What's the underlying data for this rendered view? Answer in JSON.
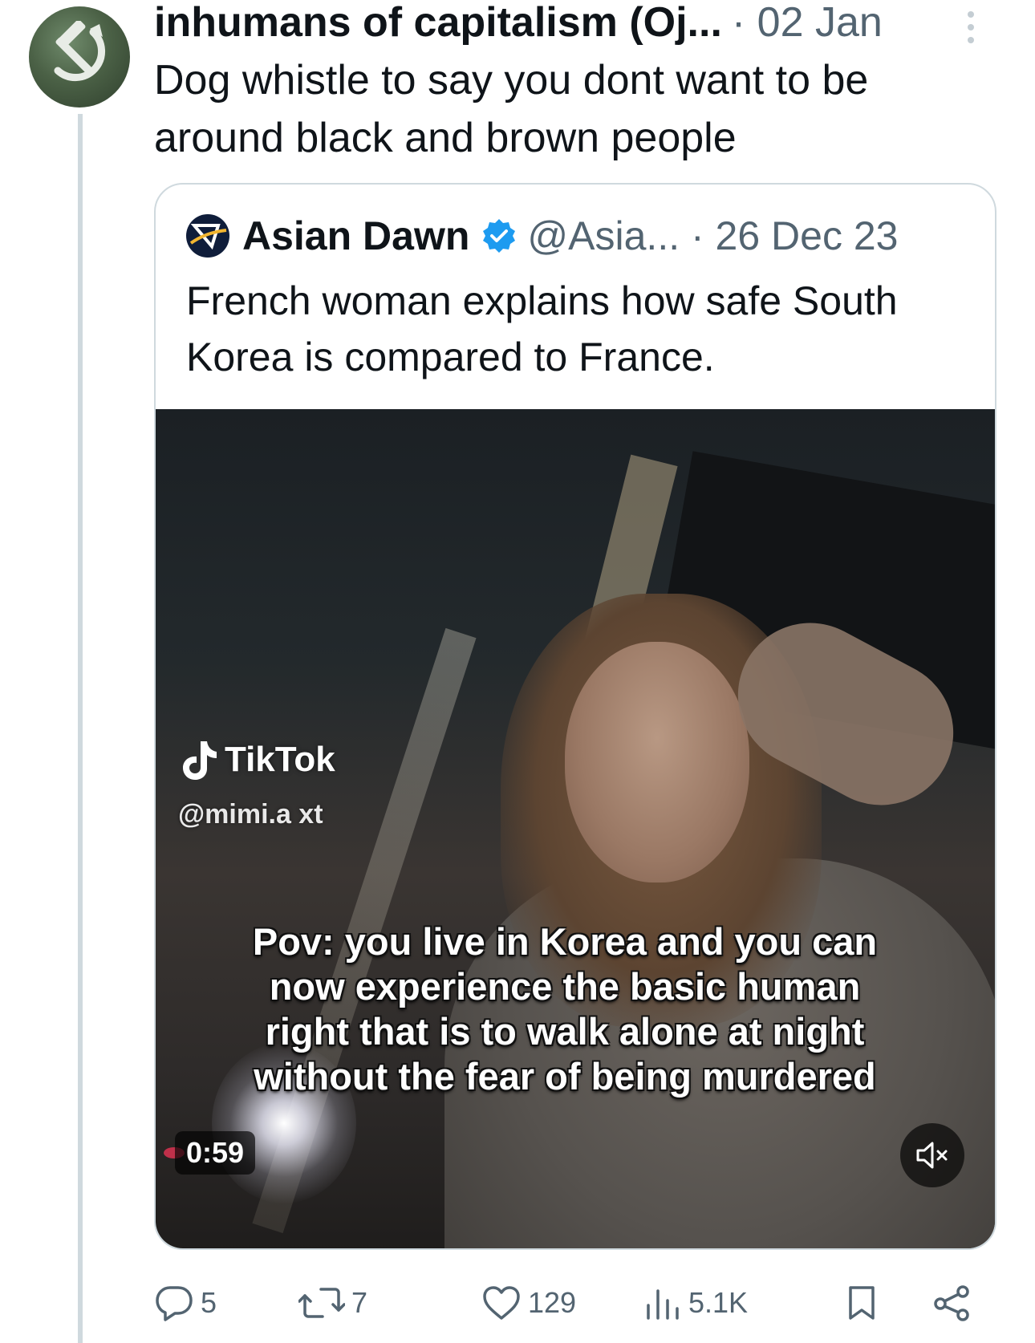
{
  "tweet": {
    "author": "inhumans of capitalism (Oj...",
    "meta": "· 02 Jan",
    "text": "Dog whistle to say you dont want to be around black and brown people"
  },
  "quoted": {
    "name": "Asian Dawn",
    "meta": "@Asia... · 26 Dec 23",
    "text": "French woman explains how safe South Korea is compared to France.",
    "video": {
      "watermark": "TikTok",
      "handle": "@mimi.a  xt",
      "caption": "Pov: you live in Korea and you can now experience the basic human right that is to walk alone at night without the fear of being murdered",
      "duration": "0:59"
    }
  },
  "actions": {
    "replies": "5",
    "reposts": "7",
    "likes": "129",
    "views": "5.1K"
  },
  "colors": {
    "text": "#0f1419",
    "secondary": "#536471",
    "verified": "#1d9bf0",
    "border": "#cfd9de"
  },
  "icons": [
    "hammer-sickle-icon",
    "more-icon",
    "asian-dawn-logo-icon",
    "verified-badge-icon",
    "tiktok-icon",
    "mute-icon",
    "reply-icon",
    "repost-icon",
    "like-icon",
    "views-icon",
    "bookmark-icon",
    "share-icon"
  ]
}
